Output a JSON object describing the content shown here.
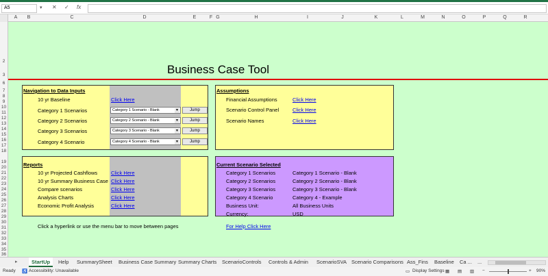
{
  "formula_bar": {
    "name_box": "A5",
    "fx": "fx"
  },
  "columns": [
    "A",
    "B",
    "C",
    "D",
    "E",
    "F",
    "G",
    "H",
    "I",
    "J",
    "K",
    "L",
    "M",
    "N",
    "O",
    "P",
    "Q",
    "R"
  ],
  "rows": [
    "2",
    "3",
    "6",
    "7",
    "8",
    "9",
    "10",
    "11",
    "12",
    "13",
    "14",
    "15",
    "16",
    "17",
    "18",
    "19",
    "20",
    "21",
    "22",
    "23",
    "24",
    "25",
    "26",
    "27",
    "28",
    "29",
    "30",
    "31",
    "32",
    "33",
    "34",
    "35",
    "36",
    "37",
    "38"
  ],
  "title": "Business Case Tool",
  "navigation": {
    "header": "Navigation to Data Inputs",
    "baseline_label": "10 yr Baseline",
    "baseline_link": "Click Here",
    "cat1_label": "Category 1 Scenarios",
    "cat2_label": "Category 2 Scenarios",
    "cat3_label": "Category 3 Scenarios",
    "cat4_label": "Category 4 Scenario",
    "cat1_select": "Category 1 Scenario - Blank",
    "cat2_select": "Category 2 Scenario - Blank",
    "cat3_select": "Category 3 Scenario - Blank",
    "cat4_select": "Category 4 Scenario - Blank",
    "jump_label": "Jump"
  },
  "assumptions": {
    "header": "Assumptions",
    "financial_label": "Financial Assumptions",
    "control_label": "Scenario Control Panel",
    "names_label": "Scenario Names",
    "link": "Click Here"
  },
  "reports": {
    "header": "Reports",
    "projected_label": "10 yr Projected Cashflows",
    "summary_label": "10 yr Summary Business Case",
    "compare_label": "Compare scenarios",
    "charts_label": "Analysis Charts",
    "profit_label": "Economic Profit Analysis",
    "link": "Click Here"
  },
  "current": {
    "header": "Current Scenario Selected",
    "cat1_label": "Category 1 Scenarios",
    "cat2_label": "Category 2 Scenarios",
    "cat3_label": "Category 3 Scenarios",
    "cat4_label": "Category 4 Scenario",
    "unit_label": "Business Unit:",
    "currency_label": "Currency:",
    "cat1_value": "Category 1 Scenario - Blank",
    "cat2_value": "Category 2 Scenario - Blank",
    "cat3_value": "Category 3 Scenario - Blank",
    "cat4_value": "Category 4 - Example",
    "unit_value": "All Business Units",
    "currency_value": "USD"
  },
  "footer": {
    "hint": "Click a hyperlink or use the menu bar to move between pages",
    "help_link": "For Help Click Here"
  },
  "tabs": {
    "startup": "StartUp",
    "help": "Help",
    "summary_sheet": "SummarySheet",
    "business_case_summary": "Business Case Summary",
    "summary_charts": "Summary Charts",
    "scenario_controls": "ScenarioControls",
    "controls_admin": "Controls & Admin",
    "scenario_sva": "ScenarioSVA",
    "scenario_comparisons": "Scenario Comparisons",
    "ass_fins": "Ass_Fins",
    "baseline": "Baseline",
    "more": "Ca ...",
    "more_sheets": "..."
  },
  "status": {
    "ready": "Ready",
    "accessibility": "Accessibility: Unavailable",
    "display_settings": "Display Settings",
    "zoom": "90%"
  },
  "colors": {
    "sheet_bg": "#ccffcc",
    "panel_yellow": "#ffff99",
    "panel_purple": "#cc99ff",
    "accent": "#217346",
    "divider": "#e00000"
  }
}
